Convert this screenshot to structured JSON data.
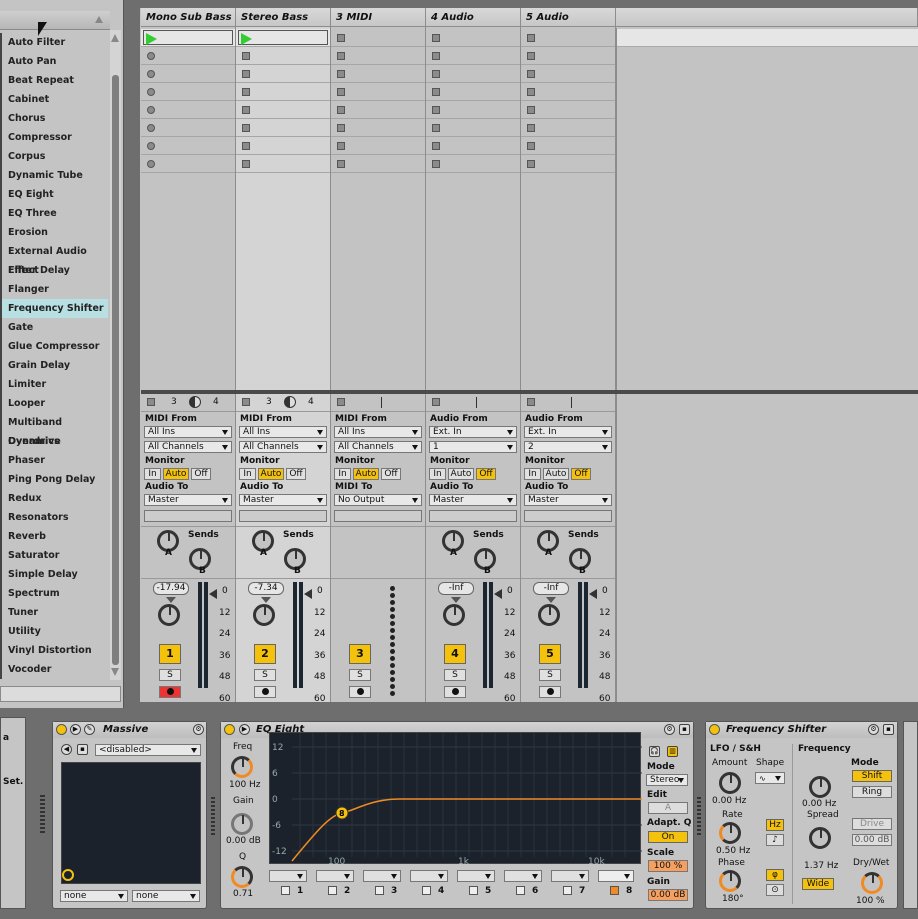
{
  "browser": {
    "items": [
      "Auto Filter",
      "Auto Pan",
      "Beat Repeat",
      "Cabinet",
      "Chorus",
      "Compressor",
      "Corpus",
      "Dynamic Tube",
      "EQ Eight",
      "EQ Three",
      "Erosion",
      "External Audio Effect",
      "Filter Delay",
      "Flanger",
      "Frequency Shifter",
      "Gate",
      "Glue Compressor",
      "Grain Delay",
      "Limiter",
      "Looper",
      "Multiband Dynamics",
      "Overdrive",
      "Phaser",
      "Ping Pong Delay",
      "Redux",
      "Resonators",
      "Reverb",
      "Saturator",
      "Simple Delay",
      "Spectrum",
      "Tuner",
      "Utility",
      "Vinyl Distortion",
      "Vocoder"
    ],
    "selected": "Frequency Shifter"
  },
  "tracks": [
    {
      "name": "Mono Sub Bass",
      "type": "midi",
      "from_label": "MIDI From",
      "from": "All Ins",
      "channel": "All Channels",
      "monitor": [
        "In",
        "Auto",
        "Off"
      ],
      "monitor_on": "Auto",
      "to_label": "Audio To",
      "to": "Master",
      "volume": "-17.94",
      "number": "1",
      "solo": "S",
      "xfade_a": "3",
      "xfade_b": "4"
    },
    {
      "name": "Stereo Bass",
      "type": "midi",
      "from_label": "MIDI From",
      "from": "All Ins",
      "channel": "All Channels",
      "monitor": [
        "In",
        "Auto",
        "Off"
      ],
      "monitor_on": "Auto",
      "to_label": "Audio To",
      "to": "Master",
      "volume": "-7.34",
      "number": "2",
      "solo": "S",
      "xfade_a": "3",
      "xfade_b": "4"
    },
    {
      "name": "3 MIDI",
      "type": "midi",
      "from_label": "MIDI From",
      "from": "All Ins",
      "channel": "All Channels",
      "monitor": [
        "In",
        "Auto",
        "Off"
      ],
      "monitor_on": "Auto",
      "to_label": "MIDI To",
      "to": "No Output",
      "volume": "",
      "number": "3",
      "solo": "S"
    },
    {
      "name": "4 Audio",
      "type": "audio",
      "from_label": "Audio From",
      "from": "Ext. In",
      "channel": "1",
      "monitor": [
        "In",
        "Auto",
        "Off"
      ],
      "monitor_on": "Off",
      "to_label": "Audio To",
      "to": "Master",
      "volume": "-Inf",
      "number": "4",
      "solo": "S"
    },
    {
      "name": "5 Audio",
      "type": "audio",
      "from_label": "Audio From",
      "from": "Ext. In",
      "channel": "2",
      "monitor": [
        "In",
        "Auto",
        "Off"
      ],
      "monitor_on": "Off",
      "to_label": "Audio To",
      "to": "Master",
      "volume": "-Inf",
      "number": "5",
      "solo": "S"
    }
  ],
  "labels": {
    "monitor": "Monitor",
    "sends": "Sends",
    "send_a": "A",
    "send_b": "B"
  },
  "meter_scale": [
    "0",
    "12",
    "24",
    "36",
    "48",
    "60"
  ],
  "left_stub": {
    "line1": "a",
    "line2": "Set."
  },
  "massive": {
    "title": "Massive",
    "program": "<disabled>",
    "left_select": "none",
    "right_select": "none"
  },
  "eq": {
    "title": "EQ Eight",
    "freq_label": "Freq",
    "freq": "100 Hz",
    "gain_label": "Gain",
    "gain": "0.00 dB",
    "q_label": "Q",
    "q": "0.71",
    "y_ticks": [
      "12",
      "6",
      "0",
      "-6",
      "-12"
    ],
    "x_ticks": [
      "100",
      "1k",
      "10k"
    ],
    "band_marker": "8",
    "mode_label": "Mode",
    "mode": "Stereo",
    "edit_label": "Edit",
    "edit": "A",
    "adapt_label": "Adapt. Q",
    "adapt": "On",
    "scale_label": "Scale",
    "scale": "100 %",
    "out_gain_label": "Gain",
    "out_gain": "0.00 dB",
    "bands": [
      "1",
      "2",
      "3",
      "4",
      "5",
      "6",
      "7",
      "8"
    ]
  },
  "fshift": {
    "title": "Frequency Shifter",
    "lfo_label": "LFO / S&H",
    "amount_label": "Amount",
    "amount": "0.00 Hz",
    "shape_label": "Shape",
    "rate_label": "Rate",
    "rate": "0.50 Hz",
    "hz_btn": "Hz",
    "phase_label": "Phase",
    "phase": "180°",
    "freq_label": "Frequency",
    "freq": "0.00 Hz",
    "spread_label": "Spread",
    "spread": "1.37 Hz",
    "wide": "Wide",
    "mode_label": "Mode",
    "shift": "Shift",
    "ring": "Ring",
    "drive": "Drive",
    "drive_val": "0.00 dB",
    "drywet_label": "Dry/Wet",
    "drywet": "100 %"
  }
}
